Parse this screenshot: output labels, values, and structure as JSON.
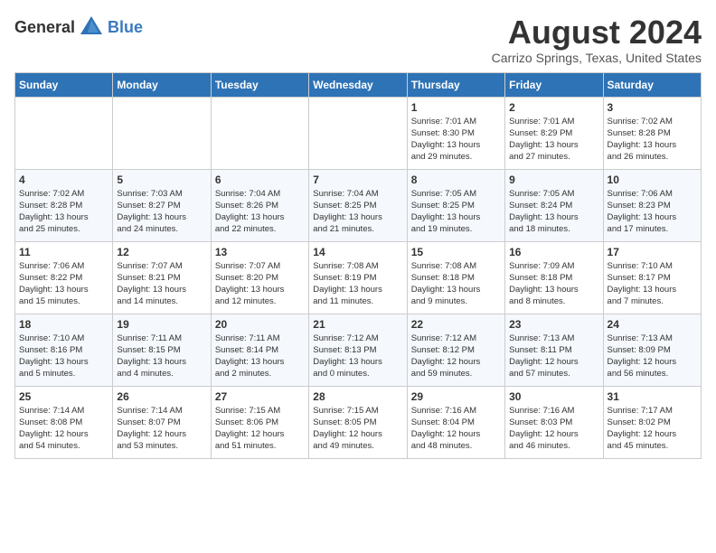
{
  "header": {
    "logo_general": "General",
    "logo_blue": "Blue",
    "title": "August 2024",
    "subtitle": "Carrizo Springs, Texas, United States"
  },
  "days_of_week": [
    "Sunday",
    "Monday",
    "Tuesday",
    "Wednesday",
    "Thursday",
    "Friday",
    "Saturday"
  ],
  "weeks": [
    [
      {
        "day": null,
        "info": ""
      },
      {
        "day": null,
        "info": ""
      },
      {
        "day": null,
        "info": ""
      },
      {
        "day": null,
        "info": ""
      },
      {
        "day": "1",
        "info": "Sunrise: 7:01 AM\nSunset: 8:30 PM\nDaylight: 13 hours\nand 29 minutes."
      },
      {
        "day": "2",
        "info": "Sunrise: 7:01 AM\nSunset: 8:29 PM\nDaylight: 13 hours\nand 27 minutes."
      },
      {
        "day": "3",
        "info": "Sunrise: 7:02 AM\nSunset: 8:28 PM\nDaylight: 13 hours\nand 26 minutes."
      }
    ],
    [
      {
        "day": "4",
        "info": "Sunrise: 7:02 AM\nSunset: 8:28 PM\nDaylight: 13 hours\nand 25 minutes."
      },
      {
        "day": "5",
        "info": "Sunrise: 7:03 AM\nSunset: 8:27 PM\nDaylight: 13 hours\nand 24 minutes."
      },
      {
        "day": "6",
        "info": "Sunrise: 7:04 AM\nSunset: 8:26 PM\nDaylight: 13 hours\nand 22 minutes."
      },
      {
        "day": "7",
        "info": "Sunrise: 7:04 AM\nSunset: 8:25 PM\nDaylight: 13 hours\nand 21 minutes."
      },
      {
        "day": "8",
        "info": "Sunrise: 7:05 AM\nSunset: 8:25 PM\nDaylight: 13 hours\nand 19 minutes."
      },
      {
        "day": "9",
        "info": "Sunrise: 7:05 AM\nSunset: 8:24 PM\nDaylight: 13 hours\nand 18 minutes."
      },
      {
        "day": "10",
        "info": "Sunrise: 7:06 AM\nSunset: 8:23 PM\nDaylight: 13 hours\nand 17 minutes."
      }
    ],
    [
      {
        "day": "11",
        "info": "Sunrise: 7:06 AM\nSunset: 8:22 PM\nDaylight: 13 hours\nand 15 minutes."
      },
      {
        "day": "12",
        "info": "Sunrise: 7:07 AM\nSunset: 8:21 PM\nDaylight: 13 hours\nand 14 minutes."
      },
      {
        "day": "13",
        "info": "Sunrise: 7:07 AM\nSunset: 8:20 PM\nDaylight: 13 hours\nand 12 minutes."
      },
      {
        "day": "14",
        "info": "Sunrise: 7:08 AM\nSunset: 8:19 PM\nDaylight: 13 hours\nand 11 minutes."
      },
      {
        "day": "15",
        "info": "Sunrise: 7:08 AM\nSunset: 8:18 PM\nDaylight: 13 hours\nand 9 minutes."
      },
      {
        "day": "16",
        "info": "Sunrise: 7:09 AM\nSunset: 8:18 PM\nDaylight: 13 hours\nand 8 minutes."
      },
      {
        "day": "17",
        "info": "Sunrise: 7:10 AM\nSunset: 8:17 PM\nDaylight: 13 hours\nand 7 minutes."
      }
    ],
    [
      {
        "day": "18",
        "info": "Sunrise: 7:10 AM\nSunset: 8:16 PM\nDaylight: 13 hours\nand 5 minutes."
      },
      {
        "day": "19",
        "info": "Sunrise: 7:11 AM\nSunset: 8:15 PM\nDaylight: 13 hours\nand 4 minutes."
      },
      {
        "day": "20",
        "info": "Sunrise: 7:11 AM\nSunset: 8:14 PM\nDaylight: 13 hours\nand 2 minutes."
      },
      {
        "day": "21",
        "info": "Sunrise: 7:12 AM\nSunset: 8:13 PM\nDaylight: 13 hours\nand 0 minutes."
      },
      {
        "day": "22",
        "info": "Sunrise: 7:12 AM\nSunset: 8:12 PM\nDaylight: 12 hours\nand 59 minutes."
      },
      {
        "day": "23",
        "info": "Sunrise: 7:13 AM\nSunset: 8:11 PM\nDaylight: 12 hours\nand 57 minutes."
      },
      {
        "day": "24",
        "info": "Sunrise: 7:13 AM\nSunset: 8:09 PM\nDaylight: 12 hours\nand 56 minutes."
      }
    ],
    [
      {
        "day": "25",
        "info": "Sunrise: 7:14 AM\nSunset: 8:08 PM\nDaylight: 12 hours\nand 54 minutes."
      },
      {
        "day": "26",
        "info": "Sunrise: 7:14 AM\nSunset: 8:07 PM\nDaylight: 12 hours\nand 53 minutes."
      },
      {
        "day": "27",
        "info": "Sunrise: 7:15 AM\nSunset: 8:06 PM\nDaylight: 12 hours\nand 51 minutes."
      },
      {
        "day": "28",
        "info": "Sunrise: 7:15 AM\nSunset: 8:05 PM\nDaylight: 12 hours\nand 49 minutes."
      },
      {
        "day": "29",
        "info": "Sunrise: 7:16 AM\nSunset: 8:04 PM\nDaylight: 12 hours\nand 48 minutes."
      },
      {
        "day": "30",
        "info": "Sunrise: 7:16 AM\nSunset: 8:03 PM\nDaylight: 12 hours\nand 46 minutes."
      },
      {
        "day": "31",
        "info": "Sunrise: 7:17 AM\nSunset: 8:02 PM\nDaylight: 12 hours\nand 45 minutes."
      }
    ]
  ]
}
